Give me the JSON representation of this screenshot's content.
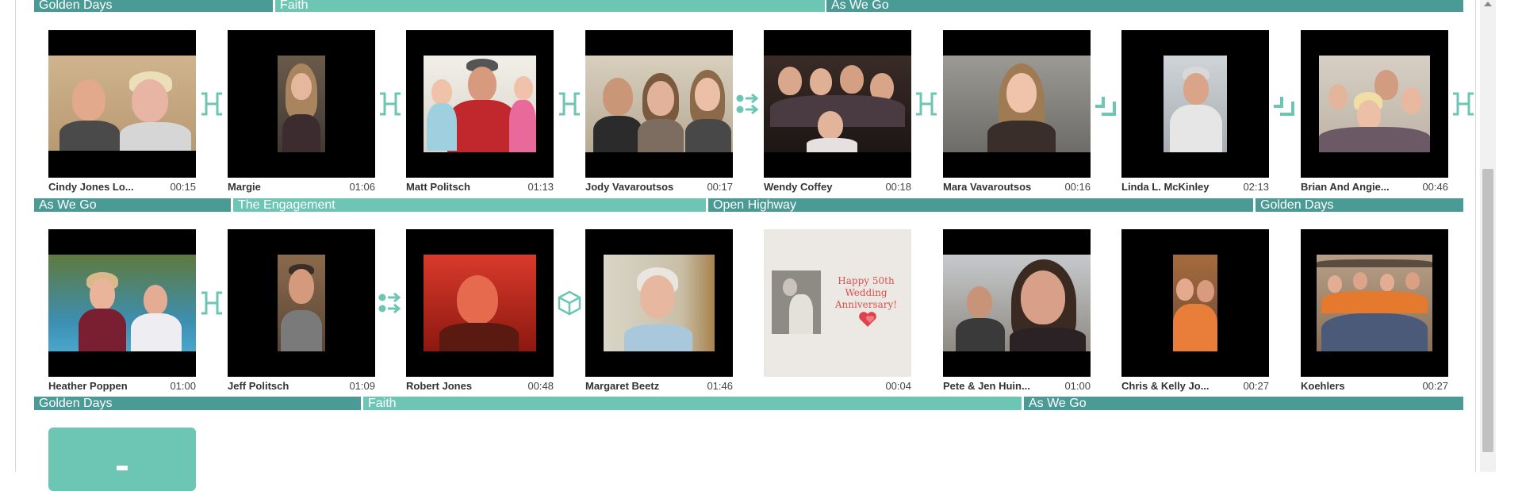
{
  "colors": {
    "dark_teal": "#4a9a96",
    "light_teal": "#6dc5b4",
    "transition_icon": "#6dc5b4"
  },
  "music_rows": [
    [
      {
        "title": "Golden Days",
        "color": "dark"
      },
      {
        "title": "Faith",
        "color": "light"
      },
      {
        "title": "As We Go",
        "color": "dark"
      }
    ],
    [
      {
        "title": "As We Go",
        "color": "dark"
      },
      {
        "title": "The Engagement",
        "color": "light"
      },
      {
        "title": "Open Highway",
        "color": "dark"
      },
      {
        "title": "Golden Days",
        "color": "dark"
      }
    ],
    [
      {
        "title": "Golden Days",
        "color": "dark"
      },
      {
        "title": "Faith",
        "color": "light"
      },
      {
        "title": "As We Go",
        "color": "dark"
      }
    ]
  ],
  "clip_rows": [
    [
      {
        "name": "Cindy Jones Lo...",
        "duration": "00:15"
      },
      {
        "name": "Margie",
        "duration": "01:06"
      },
      {
        "name": "Matt Politsch",
        "duration": "01:13"
      },
      {
        "name": "Jody Vavaroutsos",
        "duration": "00:17"
      },
      {
        "name": "Wendy Coffey",
        "duration": "00:18"
      },
      {
        "name": "Mara Vavaroutsos",
        "duration": "00:16"
      },
      {
        "name": "Linda L. McKinley",
        "duration": "02:13"
      },
      {
        "name": "Brian And Angie...",
        "duration": "00:46"
      }
    ],
    [
      {
        "name": "Heather Poppen",
        "duration": "01:00"
      },
      {
        "name": "Jeff Politsch",
        "duration": "01:09"
      },
      {
        "name": "Robert Jones",
        "duration": "00:48"
      },
      {
        "name": "Margaret Beetz",
        "duration": "01:46"
      },
      {
        "name": "",
        "duration": "00:04",
        "card_text": "Happy 50th Wedding Anniversary!"
      },
      {
        "name": "Pete & Jen Huin...",
        "duration": "01:00"
      },
      {
        "name": "Chris & Kelly Jo...",
        "duration": "00:27"
      },
      {
        "name": "Koehlers",
        "duration": "00:27"
      }
    ]
  ],
  "transitions": [
    [
      "bracket-icon",
      "bracket-icon",
      "bracket-icon",
      "dots-arrow-icon",
      "bracket-icon",
      "corner-icon",
      "corner-icon",
      "bracket-icon"
    ],
    [
      "bracket-icon",
      "dots-arrow-icon",
      "cube-icon"
    ]
  ]
}
